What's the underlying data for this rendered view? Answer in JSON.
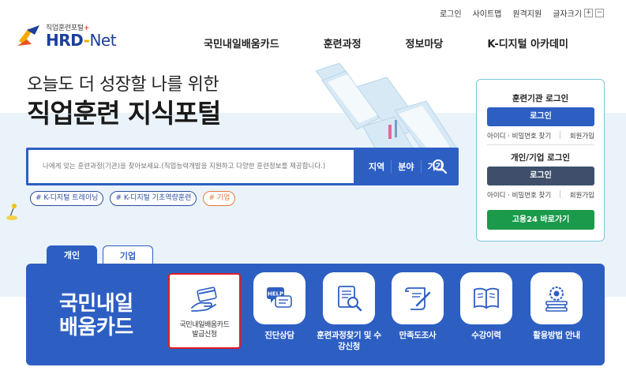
{
  "utility": {
    "login": "로그인",
    "sitemap": "사이트맵",
    "remote": "원격지원",
    "font_size": "글자크기",
    "plus": "+",
    "minus": "−"
  },
  "logo": {
    "sub": "직업훈련포털",
    "sub_plus": "+",
    "main_hrd": "HRD",
    "main_dash": "-",
    "main_net": "Net"
  },
  "nav": [
    "국민내일배움카드",
    "훈련과정",
    "정보마당",
    "K-디지털 아카데미"
  ],
  "hero": {
    "line1": "오늘도 더 성장할 나를 위한",
    "line2": "직업훈련 지식포털"
  },
  "search": {
    "placeholder": "나에게 맞는 훈련과정(기관)을 찾아보세요.(직업능력개발을 지원하고 다양한 훈련정보를 제공합니다.)",
    "filters": [
      "지역",
      "분야",
      "기간"
    ]
  },
  "tags": [
    "# K-디지털 트레이닝",
    "# K-디지털 기초역량훈련",
    "# 기업"
  ],
  "login_box": {
    "inst_title": "훈련기관 로그인",
    "inst_btn": "로그인",
    "inst_find": "아이디 · 비밀번호 찾기",
    "inst_join": "회원가입",
    "pers_title": "개인/기업 로그인",
    "pers_btn": "로그인",
    "pers_find": "아이디 · 비밀번호 찾기",
    "pers_join": "회원가입",
    "goyong_btn": "고용24 바로가기"
  },
  "tabs": {
    "personal": "개인",
    "company": "기업"
  },
  "panel": {
    "title_line1": "국민내일",
    "title_line2": "배움카드",
    "featured_line1": "국민내일배움카드",
    "featured_line2": "발급신청",
    "services": [
      {
        "label": "진단상담",
        "icon": "help-chat-icon"
      },
      {
        "label": "훈련과정찾기 및 수강신청",
        "icon": "document-search-icon"
      },
      {
        "label": "만족도조사",
        "icon": "scroll-pen-icon"
      },
      {
        "label": "수강이력",
        "icon": "book-icon"
      },
      {
        "label": "활용방법 안내",
        "icon": "gear-book-icon"
      }
    ]
  },
  "colors": {
    "primary": "#2d5fc3",
    "band": "#eaf3f9",
    "green": "#1a9a4a",
    "dark": "#3f4f6b",
    "highlight": "#e31b23"
  }
}
